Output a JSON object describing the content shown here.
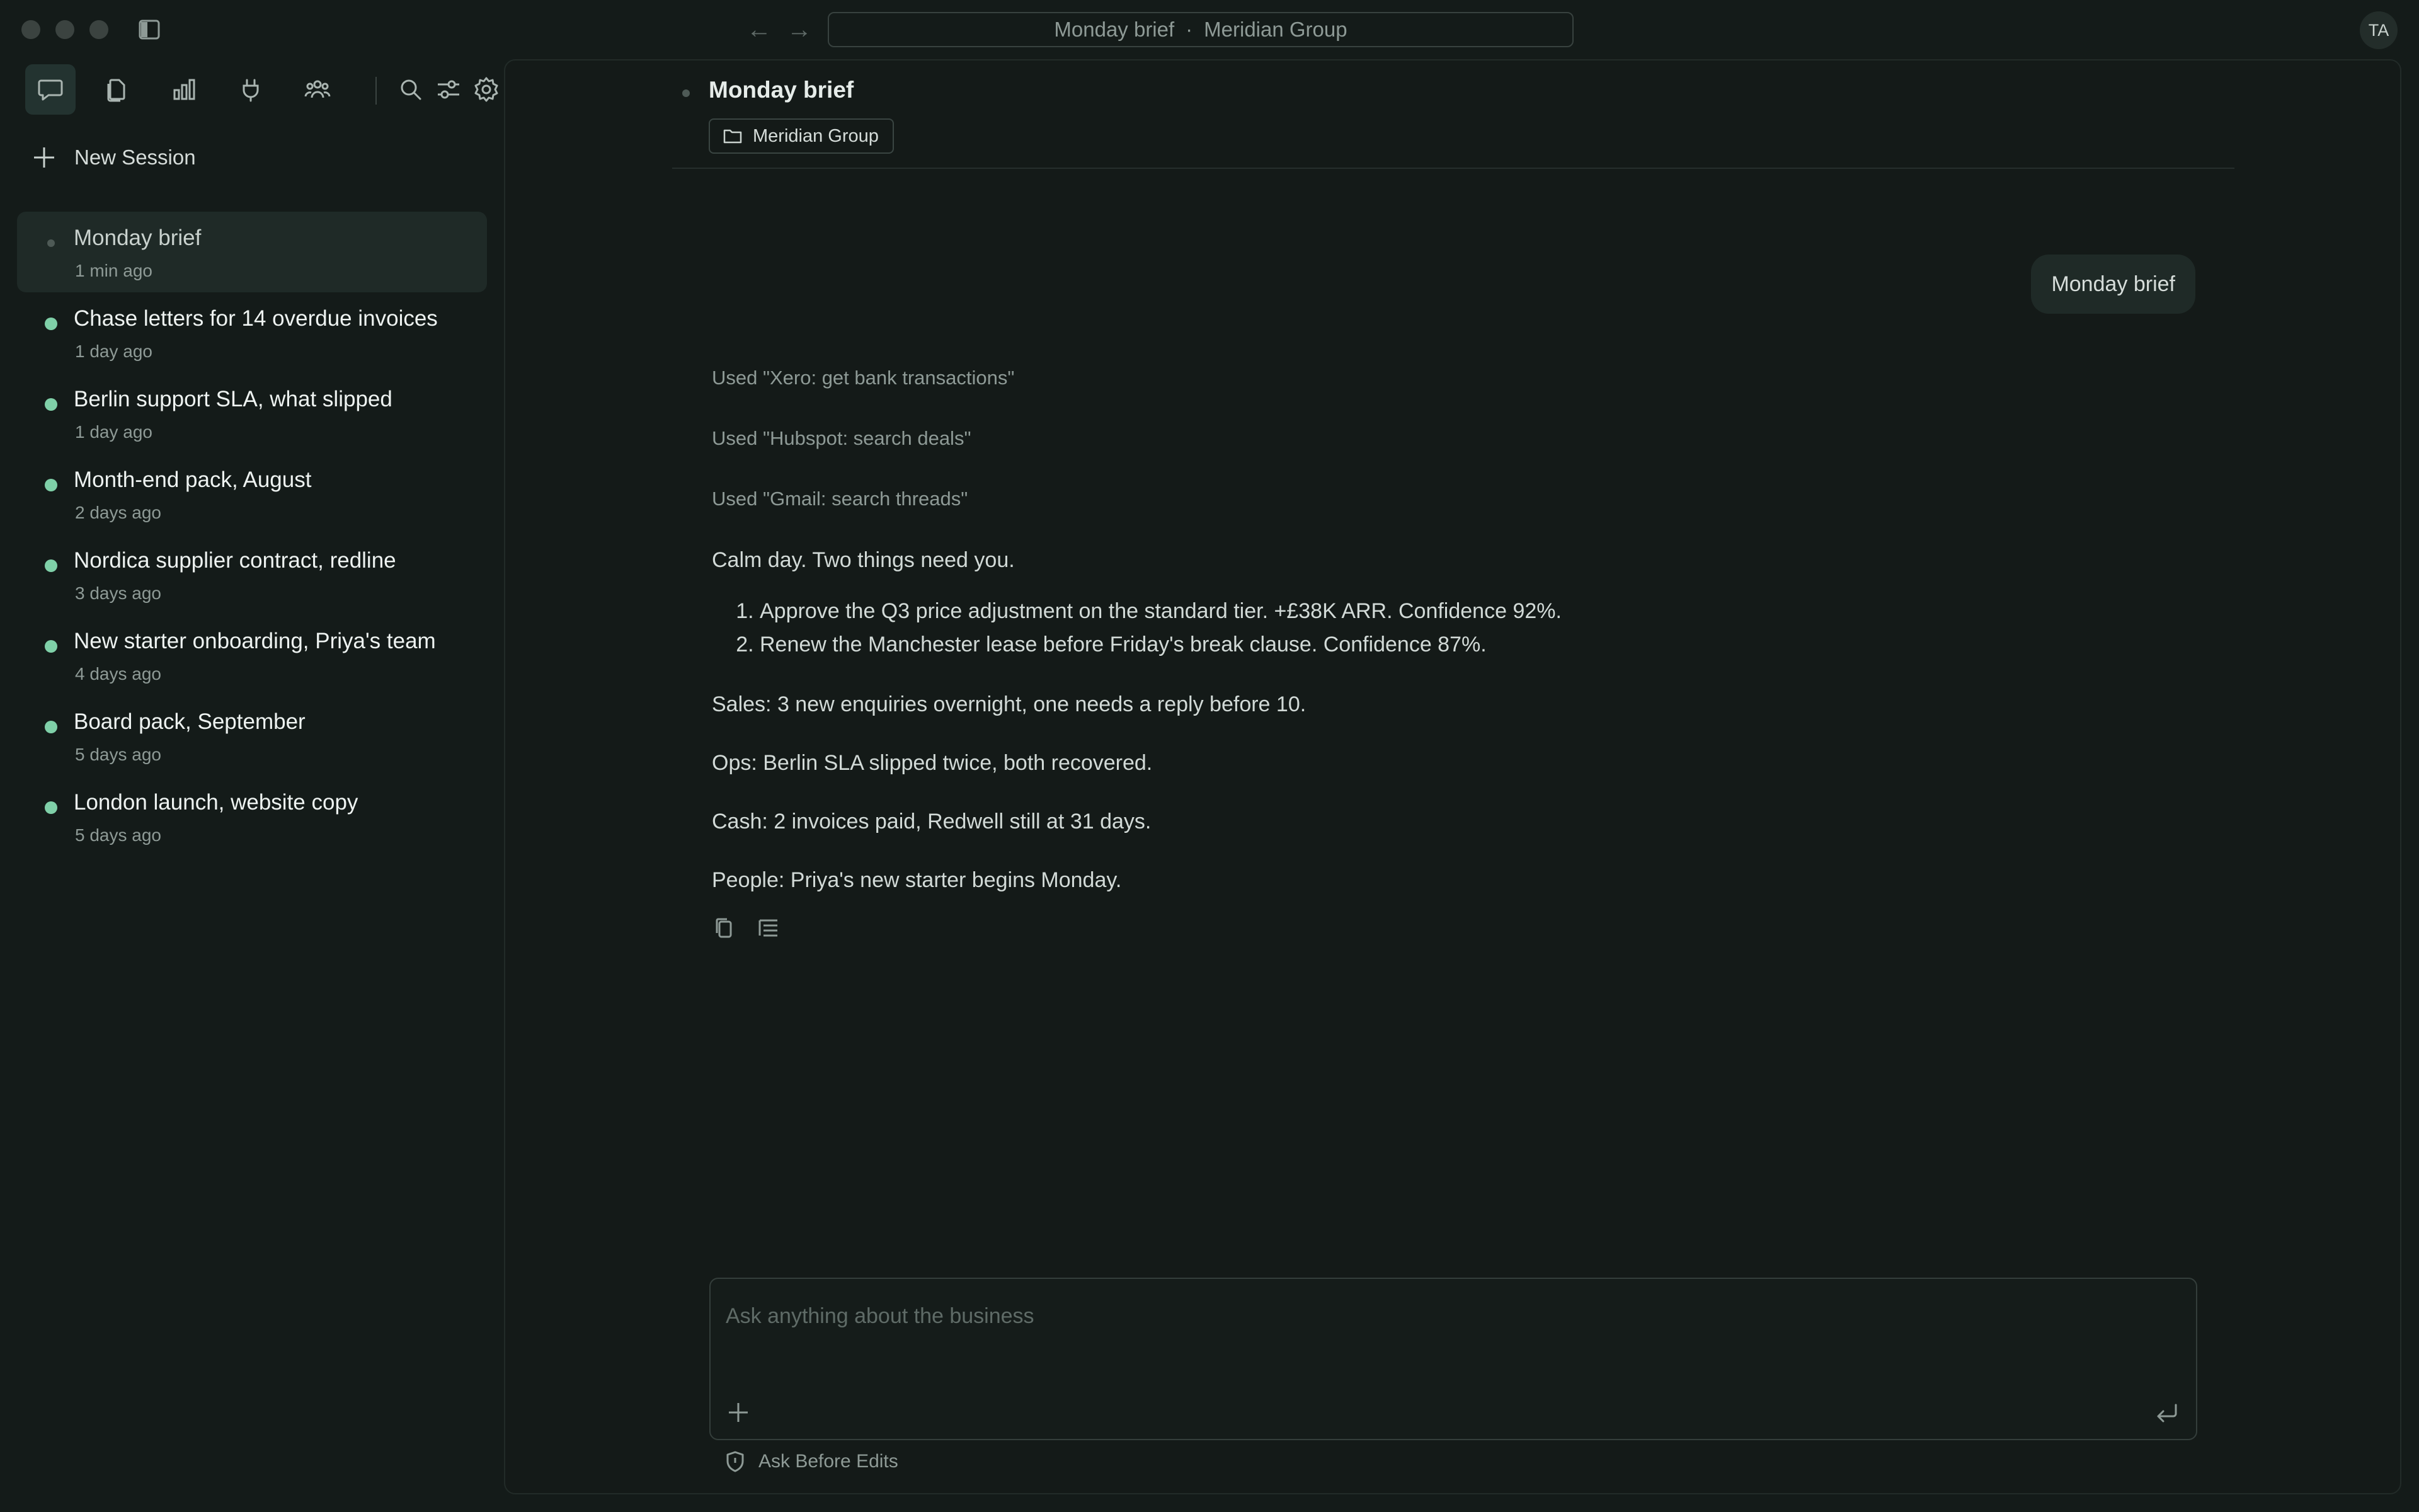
{
  "window": {
    "address": {
      "title": "Monday brief",
      "separator": "·",
      "workspace": "Meridian Group"
    },
    "nav": {
      "back": "←",
      "forward": "→"
    },
    "avatar_initials": "TA"
  },
  "sidebar": {
    "new_session_label": "New Session",
    "sessions": [
      {
        "title": "Monday brief",
        "time": "1 min ago",
        "active": true
      },
      {
        "title": "Chase letters for 14 overdue invoices",
        "time": "1 day ago"
      },
      {
        "title": "Berlin support SLA, what slipped",
        "time": "1 day ago"
      },
      {
        "title": "Month-end pack, August",
        "time": "2 days ago"
      },
      {
        "title": "Nordica supplier contract, redline",
        "time": "3 days ago"
      },
      {
        "title": "New starter onboarding, Priya's team",
        "time": "4 days ago"
      },
      {
        "title": "Board pack, September",
        "time": "5 days ago"
      },
      {
        "title": "London launch, website copy",
        "time": "5 days ago"
      }
    ]
  },
  "conversation": {
    "title": "Monday brief",
    "folder": "Meridian Group",
    "user_message": "Monday brief",
    "tool_calls": [
      "Used \"Xero: get bank transactions\"",
      "Used \"Hubspot: search deals\"",
      "Used \"Gmail: search threads\""
    ],
    "intro": "Calm day. Two things need you.",
    "items": [
      "Approve the Q3 price adjustment on the standard tier. +£38K ARR. Confidence 92%.",
      "Renew the Manchester lease before Friday's break clause. Confidence 87%."
    ],
    "summary": [
      "Sales: 3 new enquiries overnight, one needs a reply before 10.",
      "Ops: Berlin SLA slipped twice, both recovered.",
      "Cash: 2 invoices paid, Redwell still at 31 days.",
      "People: Priya's new starter begins Monday."
    ]
  },
  "composer": {
    "placeholder": "Ask anything about the business",
    "permission_label": "Ask Before Edits"
  },
  "colors": {
    "accent": "#7fd0a8",
    "background": "#141b19"
  },
  "icons": [
    "sidebar-toggle-icon",
    "chat-icon",
    "documents-icon",
    "chart-icon",
    "plug-icon",
    "team-icon",
    "search-icon",
    "sliders-icon",
    "gear-icon",
    "plus-icon",
    "folder-icon",
    "copy-icon",
    "outline-icon",
    "enter-icon",
    "shield-icon"
  ]
}
